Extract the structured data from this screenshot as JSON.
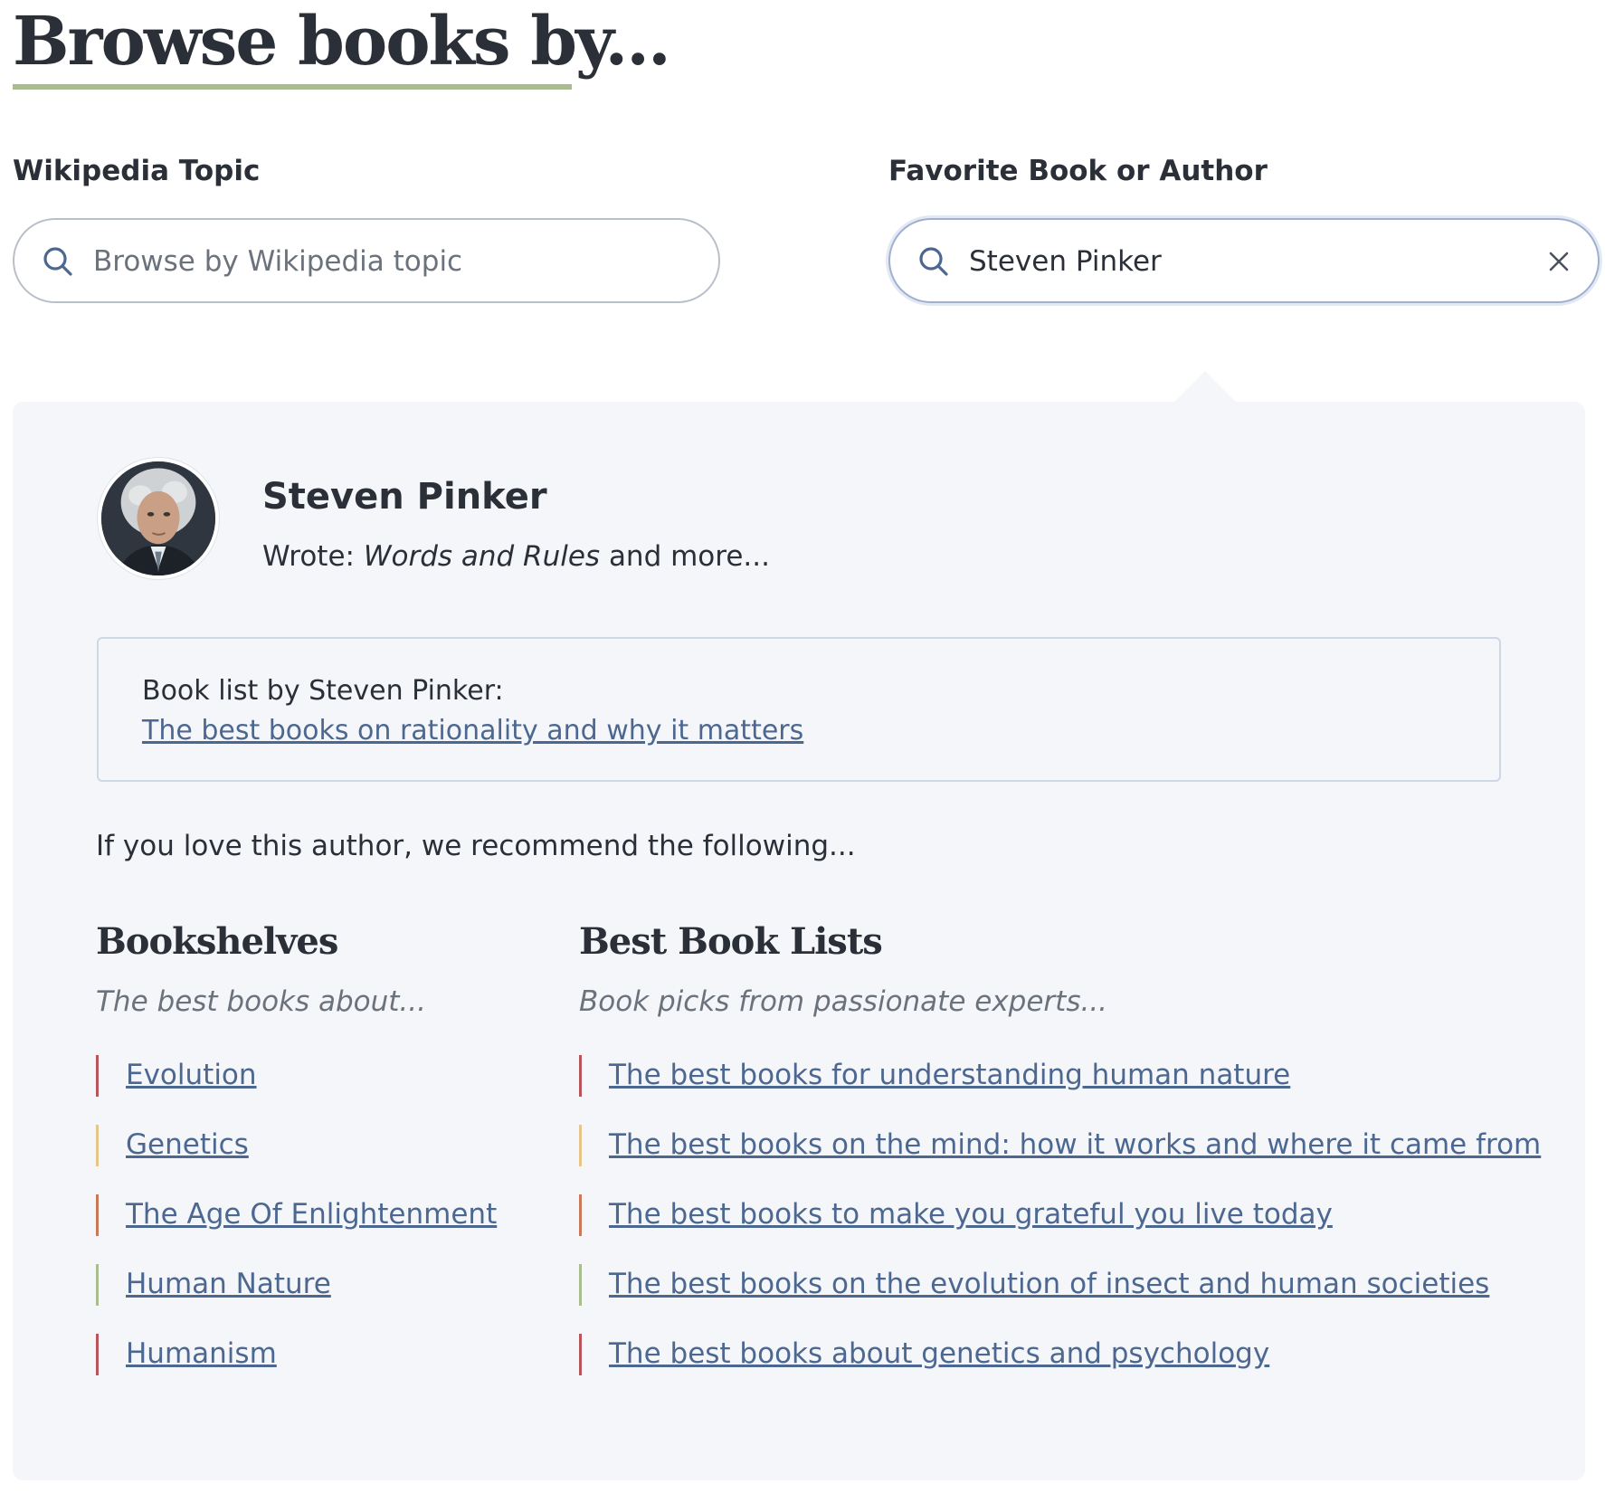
{
  "header": {
    "title": "Browse books by..."
  },
  "wiki_search": {
    "label": "Wikipedia Topic",
    "placeholder": "Browse by Wikipedia topic",
    "value": ""
  },
  "author_search": {
    "label": "Favorite Book or Author",
    "value": "Steven Pinker"
  },
  "result": {
    "author_name": "Steven Pinker",
    "wrote_prefix": "Wrote:",
    "wrote_book": "Words and Rules",
    "wrote_suffix": "and more...",
    "booklist_caption": "Book list by Steven Pinker:",
    "booklist_link": "The best books on rationality and why it matters",
    "recommend_text": "If you love this author, we recommend the following..."
  },
  "bookshelves": {
    "heading": "Bookshelves",
    "subheading": "The best books about...",
    "items": [
      {
        "label": "Evolution",
        "color": "#b8545a"
      },
      {
        "label": "Genetics",
        "color": "#e6c588"
      },
      {
        "label": "The Age Of Enlightenment",
        "color": "#c9785a"
      },
      {
        "label": "Human Nature",
        "color": "#a9bd8e"
      },
      {
        "label": "Humanism",
        "color": "#b8545a"
      }
    ]
  },
  "best_lists": {
    "heading": "Best Book Lists",
    "subheading": "Book picks from passionate experts...",
    "items": [
      {
        "label": "The best books for understanding human nature",
        "color": "#b8545a"
      },
      {
        "label": "The best books on the mind: how it works and where it came from",
        "color": "#e6c588"
      },
      {
        "label": "The best books to make you grateful you live today",
        "color": "#c9785a"
      },
      {
        "label": "The best books on the evolution of insect and human societies",
        "color": "#a9bd8e"
      },
      {
        "label": "The best books about genetics and psychology",
        "color": "#b8545a"
      }
    ]
  },
  "colors": {
    "accent_underline": "#a9bd8e",
    "link": "#4d6890",
    "panel_bg": "#f4f6fa"
  },
  "icons": {
    "search": "search-icon",
    "clear": "close-icon",
    "avatar": "author-photo"
  }
}
